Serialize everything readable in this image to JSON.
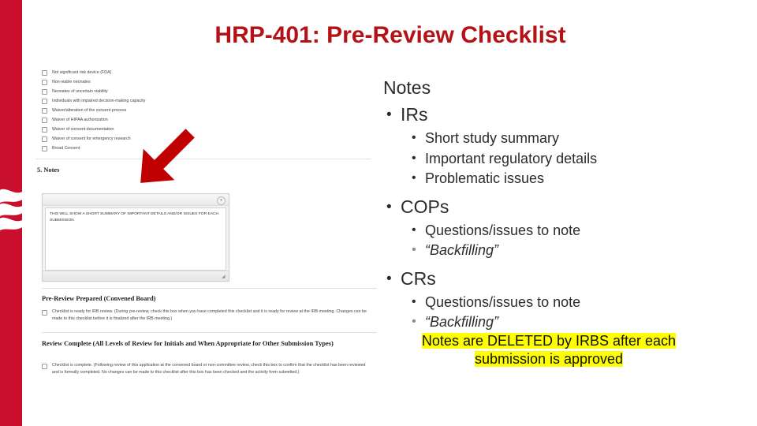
{
  "slide": {
    "title": "HRP-401: Pre-Review Checklist",
    "title_color": "#B31217",
    "accent_stripe_color": "#C8102E",
    "highlight_color": "#FFFF00"
  },
  "screenshot": {
    "checklist_items": [
      "Not significant risk device (FDA)",
      "Non-viable neonates",
      "Neonates of uncertain viability",
      "Individuals with impaired decision-making capacity",
      "Waiver/alteration of the consent process",
      "Waiver of HIPAA authorization",
      "Waiver of consent documentation",
      "Waiver of consent for emergency research",
      "Broad Consent"
    ],
    "notes_section_heading": "5. Notes",
    "notes_textarea_value": "THIS WILL SHOW A SHORT SUMMARY OF IMPORTANT DETAILS AND/OR ISSUES FOR EACH SUBMISSION",
    "notes_toolbar_button_glyph": "▾",
    "resize_grip_glyph": "◢",
    "prereview_heading": "Pre-Review Prepared (Convened Board)",
    "prereview_text": "Checklist is ready for IRB review. (During pre-review, check this box when you have completed this checklist and it is ready for review at the IRB meeting. Changes can be made to this checklist before it is finalized after the IRB meeting.)",
    "review_complete_heading": "Review Complete (All Levels of Review for Initials and When Appropriate for Other Submission Types)",
    "review_complete_text": "Checklist is complete. (Following review of this application at the convened board or non-committee review, check this box to confirm that the checklist has been reviewed and is formally completed. No changes can be made to this checklist after this box has been checked and the activity form submitted.)"
  },
  "content": {
    "heading": "Notes",
    "groups": [
      {
        "label": "IRs",
        "subitems": [
          {
            "text": "Short study summary",
            "style": "plain"
          },
          {
            "text": "Important regulatory details",
            "style": "plain"
          },
          {
            "text": "Problematic issues",
            "style": "plain"
          }
        ]
      },
      {
        "label": "COPs",
        "subitems": [
          {
            "text": "Questions/issues to note",
            "style": "plain"
          },
          {
            "text": "“Backfilling”",
            "style": "quoted"
          }
        ]
      },
      {
        "label": "CRs",
        "subitems": [
          {
            "text": "Questions/issues to note",
            "style": "plain"
          },
          {
            "text": "“Backfilling”",
            "style": "quoted"
          }
        ]
      }
    ],
    "highlight_note_line1": "Notes are DELETED by IRBS after each",
    "highlight_note_line2": "submission is approved"
  }
}
